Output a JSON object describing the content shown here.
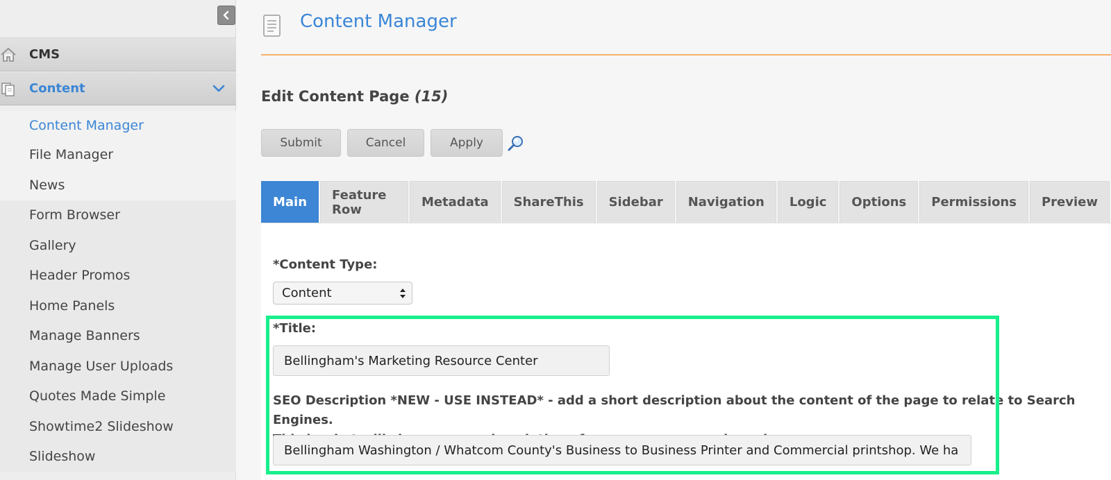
{
  "sidebar": {
    "sections": [
      {
        "label": "CMS",
        "icon": "home-icon"
      },
      {
        "label": "Content",
        "icon": "document-stack-icon",
        "expanded": true
      }
    ],
    "items": [
      {
        "label": "Content Manager",
        "active": true
      },
      {
        "label": "File Manager"
      },
      {
        "label": "News"
      },
      {
        "label": "Form Browser"
      },
      {
        "label": "Gallery"
      },
      {
        "label": "Header Promos"
      },
      {
        "label": "Home Panels"
      },
      {
        "label": "Manage Banners"
      },
      {
        "label": "Manage User Uploads"
      },
      {
        "label": "Quotes Made Simple"
      },
      {
        "label": "Showtime2 Slideshow"
      },
      {
        "label": "Slideshow"
      }
    ]
  },
  "header": {
    "title": "Content Manager"
  },
  "edit": {
    "title": "Edit Content Page",
    "page_id": "(15)"
  },
  "actions": {
    "submit": "Submit",
    "cancel": "Cancel",
    "apply": "Apply"
  },
  "tabs": [
    {
      "label": "Main",
      "active": true
    },
    {
      "label": "Feature Row"
    },
    {
      "label": "Metadata"
    },
    {
      "label": "ShareThis"
    },
    {
      "label": "Sidebar"
    },
    {
      "label": "Navigation"
    },
    {
      "label": "Logic"
    },
    {
      "label": "Options"
    },
    {
      "label": "Permissions"
    },
    {
      "label": "Preview"
    }
  ],
  "form": {
    "content_type_label": "*Content Type:",
    "content_type_value": "Content",
    "title_label": "*Title:",
    "title_value": "Bellingham's Marketing Resource Center",
    "seo_label_line1": "SEO Description *NEW - USE INSTEAD* - add a short description about the content of the page to relate to Search Engines.",
    "seo_label_line2": "This is what will show up as a description of your page on search engines:",
    "seo_value": "Bellingham Washington / Whatcom County's Business to Business Printer and Commercial printshop. We ha"
  },
  "colors": {
    "accent": "#3a86d6",
    "active_tab": "#3d85d5",
    "header_rule": "#f4b26a",
    "highlight": "#17f08c"
  }
}
